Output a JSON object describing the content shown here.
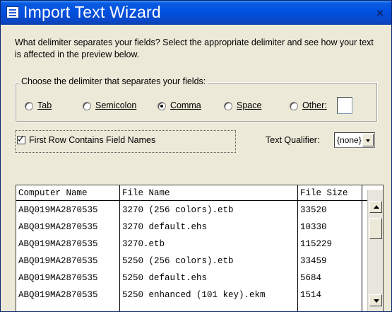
{
  "window": {
    "title": "Import Text Wizard",
    "close_glyph": "×",
    "title_icon": "wizard-icon"
  },
  "intro_text": "What delimiter separates your fields? Select the appropriate delimiter and see how your text is affected in the preview below.",
  "delimiter_group": {
    "legend": "Choose the delimiter that separates your fields:",
    "options": [
      {
        "label": "Tab",
        "selected": false
      },
      {
        "label": "Semicolon",
        "selected": false
      },
      {
        "label": "Comma",
        "selected": true
      },
      {
        "label": "Space",
        "selected": false
      },
      {
        "label": "Other:",
        "selected": false
      }
    ],
    "other_value": ""
  },
  "first_row": {
    "label": "First Row Contains Field Names",
    "checked": true,
    "mark": "✓"
  },
  "text_qualifier": {
    "label": "Text Qualifier:",
    "value": "{none}"
  },
  "preview": {
    "columns": [
      "Computer Name",
      "File Name",
      "File Size"
    ],
    "rows": [
      [
        "ABQ019MA2870535",
        "3270 (256 colors).etb",
        "33520"
      ],
      [
        "ABQ019MA2870535",
        "3270 default.ehs",
        "10330"
      ],
      [
        "ABQ019MA2870535",
        "3270.etb",
        "115229"
      ],
      [
        "ABQ019MA2870535",
        "5250 (256 colors).etb",
        "33459"
      ],
      [
        "ABQ019MA2870535",
        "5250 default.ehs",
        "5684"
      ],
      [
        "ABQ019MA2870535",
        "5250 enhanced (101 key).ekm",
        "1514"
      ]
    ]
  }
}
